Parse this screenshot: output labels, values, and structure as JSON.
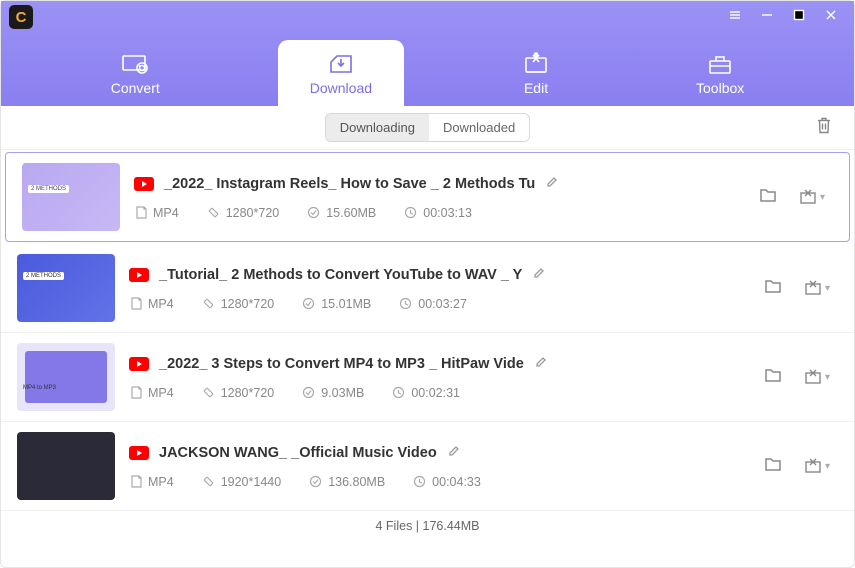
{
  "nav": {
    "convert": "Convert",
    "download": "Download",
    "edit": "Edit",
    "toolbox": "Toolbox"
  },
  "subtabs": {
    "downloading": "Downloading",
    "downloaded": "Downloaded"
  },
  "items": [
    {
      "title": "_2022_ Instagram Reels_ How to Save _ 2 Methods Tu",
      "format": "MP4",
      "resolution": "1280*720",
      "size": "15.60MB",
      "duration": "00:03:13"
    },
    {
      "title": "_Tutorial_ 2 Methods to Convert YouTube to WAV _ Y",
      "format": "MP4",
      "resolution": "1280*720",
      "size": "15.01MB",
      "duration": "00:03:27"
    },
    {
      "title": "_2022_ 3 Steps to Convert MP4 to MP3 _ HitPaw Vide",
      "format": "MP4",
      "resolution": "1280*720",
      "size": "9.03MB",
      "duration": "00:02:31"
    },
    {
      "title": "JACKSON WANG_ _Official Music Video",
      "format": "MP4",
      "resolution": "1920*1440",
      "size": "136.80MB",
      "duration": "00:04:33"
    }
  ],
  "footer": "4 Files | 176.44MB"
}
